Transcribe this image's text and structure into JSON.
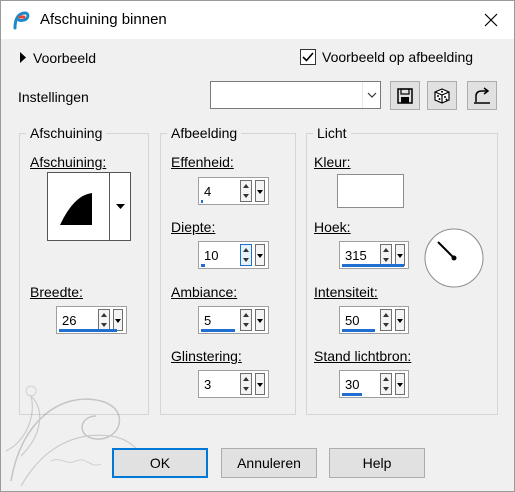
{
  "window": {
    "title": "Afschuining binnen"
  },
  "preview": {
    "toggle_label": "Voorbeeld",
    "on_image_label": "Voorbeeld op afbeelding",
    "on_image_checked": true
  },
  "settings": {
    "label": "Instellingen",
    "value": ""
  },
  "bevel": {
    "group_title": "Afschuining",
    "bevel_label": "Afschuining:",
    "width_label": "Breedte:",
    "width_value": "26"
  },
  "image": {
    "group_title": "Afbeelding",
    "smoothness_label": "Effenheid:",
    "smoothness_value": "4",
    "depth_label": "Diepte:",
    "depth_value": "10",
    "ambience_label": "Ambiance:",
    "ambience_value": "5",
    "shininess_label": "Glinstering:",
    "shininess_value": "3"
  },
  "light": {
    "group_title": "Licht",
    "color_label": "Kleur:",
    "color": "#ffffff",
    "angle_label": "Hoek:",
    "angle_value": "315",
    "intensity_label": "Intensiteit:",
    "intensity_value": "50",
    "elevation_label": "Stand lichtbron:",
    "elevation_value": "30"
  },
  "buttons": {
    "ok": "OK",
    "cancel": "Annuleren",
    "help": "Help"
  },
  "colors": {
    "accent": "#0078d7",
    "bar": "#1f6fd1"
  }
}
